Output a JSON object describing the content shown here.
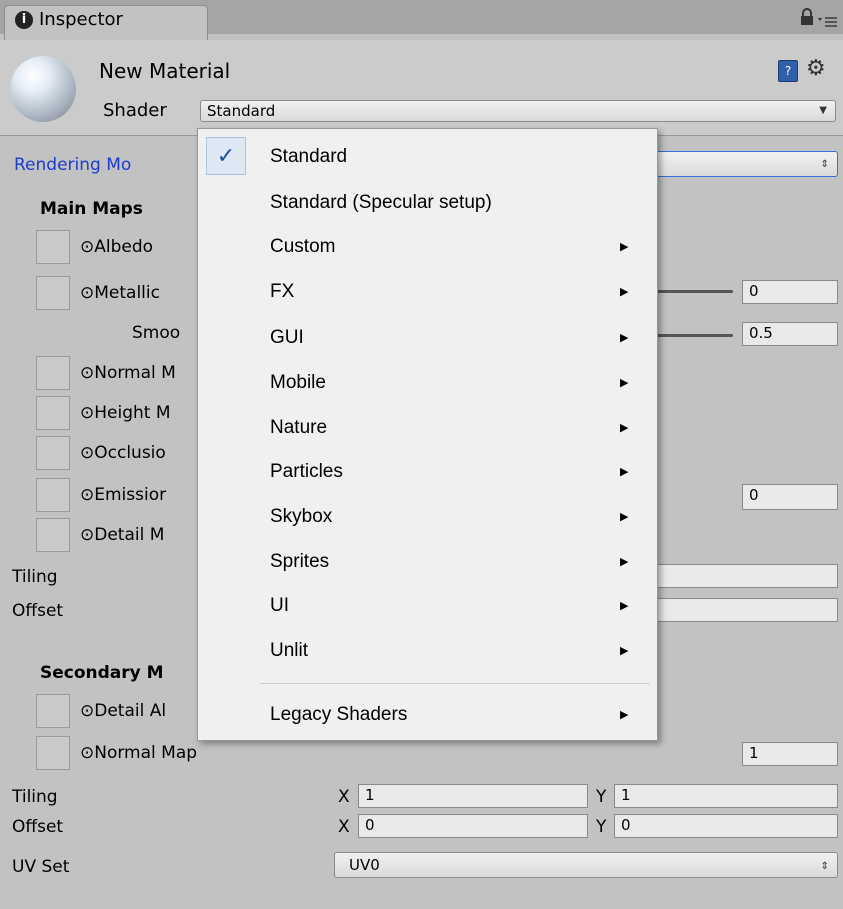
{
  "window": {
    "tab_label": "Inspector",
    "tab_icon": "info-icon"
  },
  "header": {
    "material_name": "New Material",
    "shader_label": "Shader",
    "shader_value": "Standard"
  },
  "rendering_mode": {
    "label": "Rendering Mo"
  },
  "main_maps": {
    "heading": "Main Maps",
    "albedo": "⊙Albedo",
    "metallic": "⊙Metallic",
    "metallic_value": "0",
    "smoothness": "Smoo",
    "smoothness_value": "0.5",
    "normal": "⊙Normal M",
    "height": "⊙Height M",
    "occlusion": "⊙Occlusio",
    "emission": "⊙Emissior",
    "emission_value": "0",
    "detail_mask": "⊙Detail M",
    "tiling": "Tiling",
    "offset": "Offset"
  },
  "secondary_maps": {
    "heading": "Secondary M",
    "detail_albedo": "⊙Detail Al",
    "normal_map": "⊙Normal Map",
    "normal_value": "1",
    "tiling": "Tiling",
    "offset": "Offset",
    "tiling_x": "1",
    "tiling_y": "1",
    "offset_x": "0",
    "offset_y": "0",
    "x_label": "X",
    "y_label": "Y",
    "uv_set_label": "UV Set",
    "uv_set_value": "UV0"
  },
  "shader_menu": {
    "checked": "✓",
    "items": [
      {
        "label": "Standard"
      },
      {
        "label": "Standard (Specular setup)"
      },
      {
        "label": "Custom"
      },
      {
        "label": "FX"
      },
      {
        "label": "GUI"
      },
      {
        "label": "Mobile"
      },
      {
        "label": "Nature"
      },
      {
        "label": "Particles"
      },
      {
        "label": "Skybox"
      },
      {
        "label": "Sprites"
      },
      {
        "label": "UI"
      },
      {
        "label": "Unlit"
      },
      {
        "label": "Legacy Shaders"
      }
    ],
    "submenu_arrow": "▶"
  },
  "colors": {
    "link_blue": "#1a3ccc",
    "check_blue": "#1a4f9c"
  }
}
